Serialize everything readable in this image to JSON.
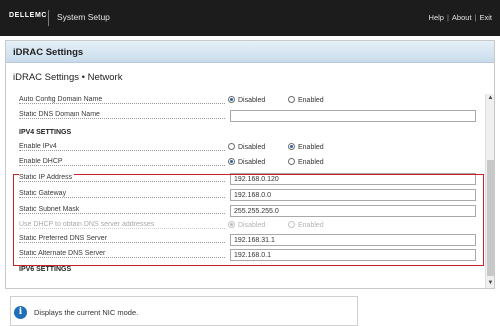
{
  "topbar": {
    "brand": "DELLEMC",
    "app_title": "System Setup",
    "links": {
      "help": "Help",
      "about": "About",
      "exit": "Exit"
    }
  },
  "section": {
    "title": "iDRAC Settings"
  },
  "page": {
    "title": "iDRAC Settings • Network"
  },
  "settings": {
    "auto_config_domain_name": {
      "label": "Auto Config Domain Name",
      "opt_disabled": "Disabled",
      "opt_enabled": "Enabled",
      "selected": "Disabled"
    },
    "static_dns_domain_name": {
      "label": "Static DNS Domain Name",
      "value": ""
    },
    "ipv4_heading": "IPV4 SETTINGS",
    "enable_ipv4": {
      "label": "Enable IPv4",
      "opt_disabled": "Disabled",
      "opt_enabled": "Enabled",
      "selected": "Enabled"
    },
    "enable_dhcp": {
      "label": "Enable DHCP",
      "opt_disabled": "Disabled",
      "opt_enabled": "Enabled",
      "selected": "Disabled"
    },
    "static_ip": {
      "label": "Static IP Address",
      "value": "192.168.0.120"
    },
    "static_gateway": {
      "label": "Static Gateway",
      "value": "192.168.0.0"
    },
    "subnet_mask": {
      "label": "Static Subnet Mask",
      "value": "255.255.255.0"
    },
    "dhcp_dns": {
      "label": "Use DHCP to obtain DNS server addresses",
      "opt_disabled": "Disabled",
      "opt_enabled": "Enabled",
      "selected": "Disabled"
    },
    "preferred_dns": {
      "label": "Static Preferred DNS Server",
      "value": "192.168.31.1"
    },
    "alternate_dns": {
      "label": "Static Alternate DNS Server",
      "value": "192.168.0.1"
    },
    "ipv6_heading": "IPV6 SETTINGS"
  },
  "help": {
    "icon": "info-icon",
    "text": "Displays the current NIC mode."
  },
  "colors": {
    "topbar_bg": "#1c1c1c",
    "highlight_border": "#c8202b",
    "radio_selected": "#2f5fa5",
    "info_icon": "#1f6fb8"
  }
}
